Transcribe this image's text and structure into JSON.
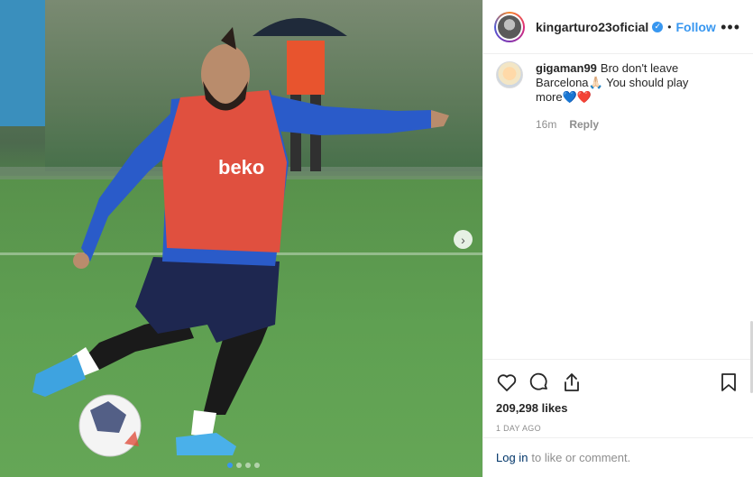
{
  "post": {
    "username": "kingarturo23oficial",
    "verified_mark": "✓",
    "bullet": "•",
    "follow_label": "Follow",
    "more_icon": "•••",
    "carousel": {
      "total_slides": 4,
      "active_slide": 1,
      "next_icon": "›"
    }
  },
  "comment": {
    "username": "gigaman99",
    "text": "Bro don't leave Barcelona🙏🏻 You should play more💙❤️",
    "time": "16m",
    "reply_label": "Reply"
  },
  "actions": {
    "likes": "209,298 likes",
    "time_ago": "1 DAY AGO"
  },
  "login": {
    "link_label": "Log in",
    "suffix": "to like or comment."
  },
  "colors": {
    "accent": "#3897f0",
    "text": "#262626",
    "muted": "#8e8e8e",
    "link": "#003569"
  },
  "icons": {
    "like": "heart-icon",
    "comment": "comment-bubble-icon",
    "share": "share-icon",
    "save": "bookmark-icon"
  }
}
